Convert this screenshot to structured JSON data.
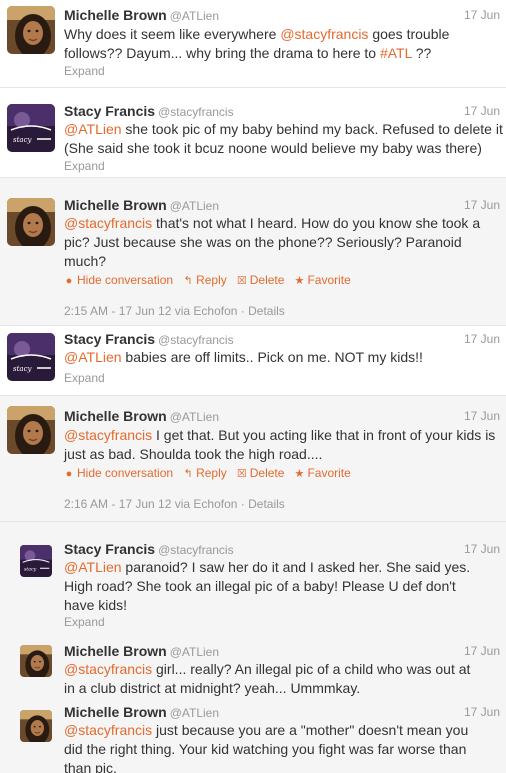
{
  "expand_label": "Expand",
  "action_labels": {
    "hide": "Hide conversation",
    "reply": "Reply",
    "delete": "Delete",
    "favorite": "Favorite",
    "details": "Details"
  },
  "colors": {
    "link": "#e46a2e",
    "muted": "#999999",
    "text": "#333333",
    "conversation_bg": "#f5f5f5"
  },
  "tweets": [
    {
      "fullname": "Michelle Brown",
      "username": "@ATLien",
      "date": "17 Jun",
      "avatar": "michelle-avatar",
      "text_parts": [
        {
          "t": "Why does it seem like everywhere "
        },
        {
          "t": "@stacyfrancis",
          "link": "mention"
        },
        {
          "t": " goes trouble follows?? Dayum... why bring the drama to here to "
        },
        {
          "t": "#ATL",
          "link": "hashtag"
        },
        {
          "t": " ??"
        }
      ],
      "expand": "Expand"
    },
    {
      "fullname": "Stacy Francis",
      "username": "@stacyfrancis",
      "date": "17 Jun",
      "avatar": "stacy-avatar",
      "text_parts": [
        {
          "t": "@ATLien",
          "link": "mention"
        },
        {
          "t": " she took pic of my baby behind my back. Refused to delete it (She said she took it bcuz noone would believe my baby was there)"
        }
      ],
      "expand": "Expand"
    },
    {
      "fullname": "Michelle Brown",
      "username": "@ATLien",
      "date": "17 Jun",
      "avatar": "michelle-avatar",
      "text_parts": [
        {
          "t": "@stacyfrancis",
          "link": "mention"
        },
        {
          "t": " that's not what I heard. How do you know she took a pic? Just because she was on the phone?? Seriously? Paranoid much?"
        }
      ],
      "actions": true,
      "meta": "2:15 AM - 17 Jun 12 via Echofon · Details"
    },
    {
      "fullname": "Stacy Francis",
      "username": "@stacyfrancis",
      "date": "17 Jun",
      "avatar": "stacy-avatar",
      "text_parts": [
        {
          "t": "@ATLien",
          "link": "mention"
        },
        {
          "t": " babies are off limits.. Pick on me. NOT my kids!!"
        }
      ],
      "expand": "Expand"
    },
    {
      "fullname": "Michelle Brown",
      "username": "@ATLien",
      "date": "17 Jun",
      "avatar": "michelle-avatar",
      "text_parts": [
        {
          "t": "@stacyfrancis",
          "link": "mention"
        },
        {
          "t": " I get that. But you acting like that in front of your kids is just as bad. Shoulda took the high road...."
        }
      ],
      "actions": true,
      "meta": "2:16 AM - 17 Jun 12 via Echofon · Details"
    },
    {
      "fullname": "Stacy Francis",
      "username": "@stacyfrancis",
      "date": "17 Jun",
      "avatar": "stacy-avatar",
      "text_parts": [
        {
          "t": "@ATLien",
          "link": "mention"
        },
        {
          "t": " paranoid? I saw her do it and I asked her. She said yes. High road? She took an illegal pic of a baby! Please U def don't have kids!"
        }
      ],
      "expand": "Expand"
    },
    {
      "fullname": "Michelle Brown",
      "username": "@ATLien",
      "date": "17 Jun",
      "avatar": "michelle-avatar",
      "text_parts": [
        {
          "t": "@stacyfrancis",
          "link": "mention"
        },
        {
          "t": " girl... really? An illegal pic of a child who was out at in a club district at midnight? yeah... Ummmkay."
        }
      ]
    },
    {
      "fullname": "Michelle Brown",
      "username": "@ATLien",
      "date": "17 Jun",
      "avatar": "michelle-avatar",
      "text_parts": [
        {
          "t": "@stacyfrancis",
          "link": "mention"
        },
        {
          "t": " just because you are a \"mother\" doesn't mean you did the right thing. Your kid watching you fight was far worse than than pic."
        }
      ]
    }
  ]
}
